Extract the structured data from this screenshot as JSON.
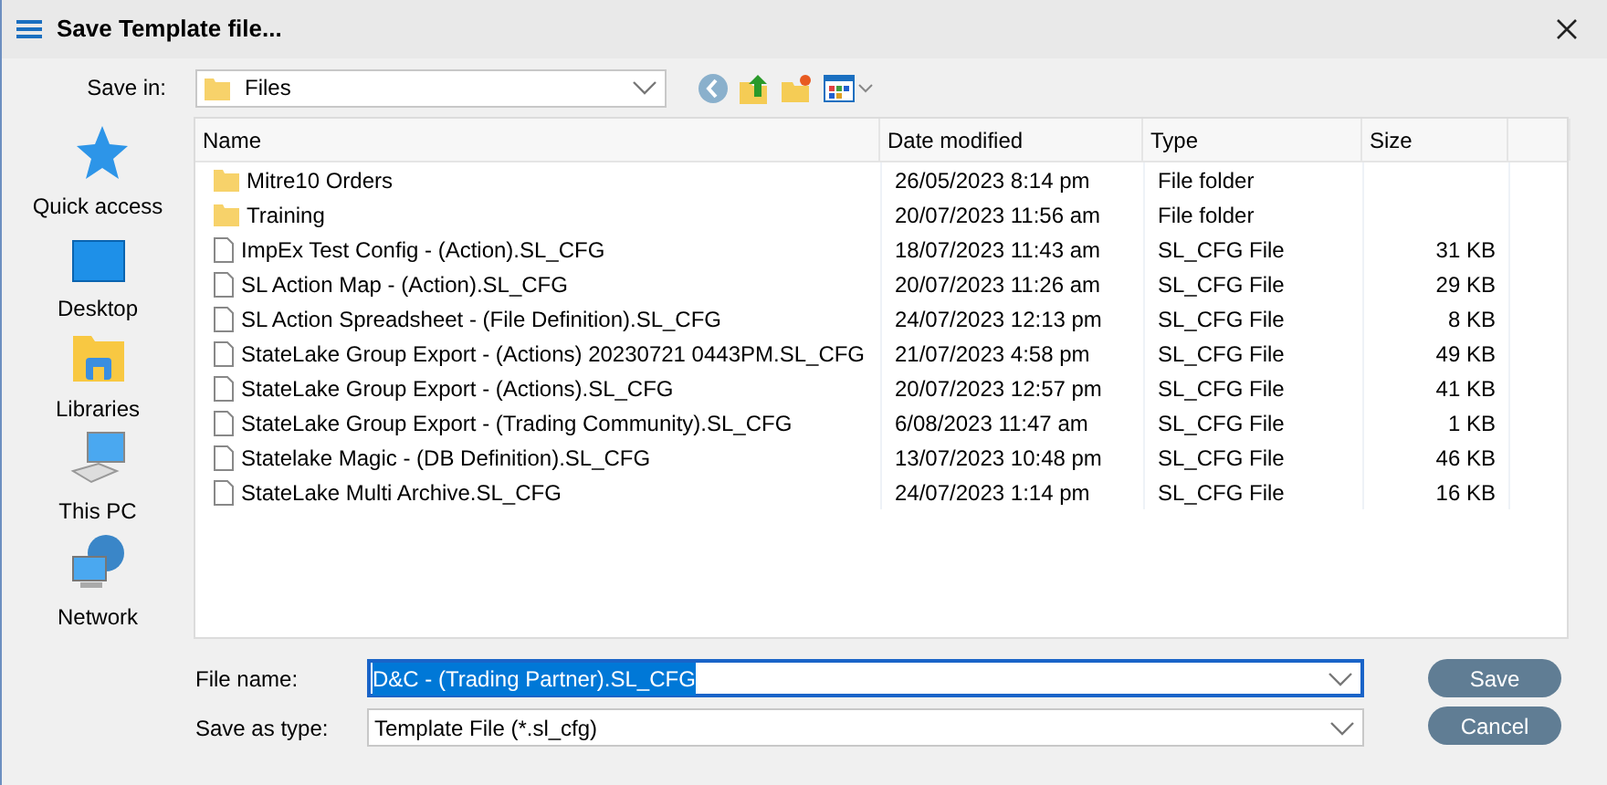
{
  "window": {
    "title": "Save Template file..."
  },
  "save_in": {
    "label": "Save in:",
    "value": "Files"
  },
  "places": [
    {
      "label": "Quick access",
      "kind": "star"
    },
    {
      "label": "Desktop",
      "kind": "desktop"
    },
    {
      "label": "Libraries",
      "kind": "libraries"
    },
    {
      "label": "This PC",
      "kind": "pc"
    },
    {
      "label": "Network",
      "kind": "network"
    }
  ],
  "table": {
    "columns": [
      "Name",
      "Date modified",
      "Type",
      "Size"
    ],
    "rows": [
      {
        "kind": "folder",
        "name": "Mitre10 Orders",
        "date": "26/05/2023 8:14 pm",
        "type": "File folder"
      },
      {
        "kind": "folder",
        "name": "Training",
        "date": "20/07/2023 11:56 am",
        "type": "File folder"
      },
      {
        "kind": "file",
        "name": "ImpEx Test Config - (Action).SL_CFG",
        "date": "18/07/2023 11:43 am",
        "type": "SL_CFG File",
        "size": "31 KB"
      },
      {
        "kind": "file",
        "name": "SL Action Map - (Action).SL_CFG",
        "date": "20/07/2023 11:26 am",
        "type": "SL_CFG File",
        "size": "29 KB"
      },
      {
        "kind": "file",
        "name": "SL Action Spreadsheet - (File Definition).SL_CFG",
        "date": "24/07/2023 12:13 pm",
        "type": "SL_CFG File",
        "size": "8 KB"
      },
      {
        "kind": "file",
        "name": "StateLake Group Export - (Actions) 20230721 0443PM.SL_CFG",
        "date": "21/07/2023 4:58 pm",
        "type": "SL_CFG File",
        "size": "49 KB"
      },
      {
        "kind": "file",
        "name": "StateLake Group Export - (Actions).SL_CFG",
        "date": "20/07/2023 12:57 pm",
        "type": "SL_CFG File",
        "size": "41 KB"
      },
      {
        "kind": "file",
        "name": "StateLake Group Export - (Trading Community).SL_CFG",
        "date": "6/08/2023 11:47 am",
        "type": "SL_CFG File",
        "size": "1 KB"
      },
      {
        "kind": "file",
        "name": "Statelake Magic - (DB Definition).SL_CFG",
        "date": "13/07/2023 10:48 pm",
        "type": "SL_CFG File",
        "size": "46 KB"
      },
      {
        "kind": "file",
        "name": "StateLake Multi Archive.SL_CFG",
        "date": "24/07/2023 1:14 pm",
        "type": "SL_CFG File",
        "size": "16 KB"
      }
    ]
  },
  "file_name": {
    "label": "File name:",
    "value": "D&C - (Trading Partner).SL_CFG"
  },
  "save_as_type": {
    "label": "Save as type:",
    "value": "Template File (*.sl_cfg)"
  },
  "buttons": [
    "Save",
    "Cancel"
  ]
}
